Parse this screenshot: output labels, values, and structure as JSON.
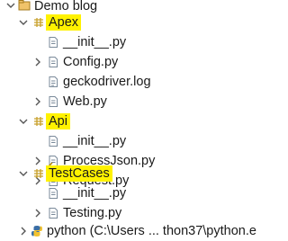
{
  "explorer": {
    "root": {
      "label": "Demo blog"
    },
    "packages": [
      {
        "label": "Apex",
        "files": [
          "__init__.py",
          "Config.py",
          "geckodriver.log",
          "Web.py"
        ]
      },
      {
        "label": "Api",
        "files": [
          "__init__.py",
          "ProcessJson.py",
          "Request.py"
        ]
      },
      {
        "label": "TestCases",
        "files": [
          "__init__.py",
          "Testing.py"
        ]
      }
    ],
    "interpreter": {
      "label": "python  (C:\\Users ... thon37\\python.e"
    }
  },
  "colors": {
    "highlight": "#fff200",
    "package_icon": "#c8a02a",
    "file_icon": "#7a8a9a",
    "python_icon": "#3a6ea5"
  }
}
